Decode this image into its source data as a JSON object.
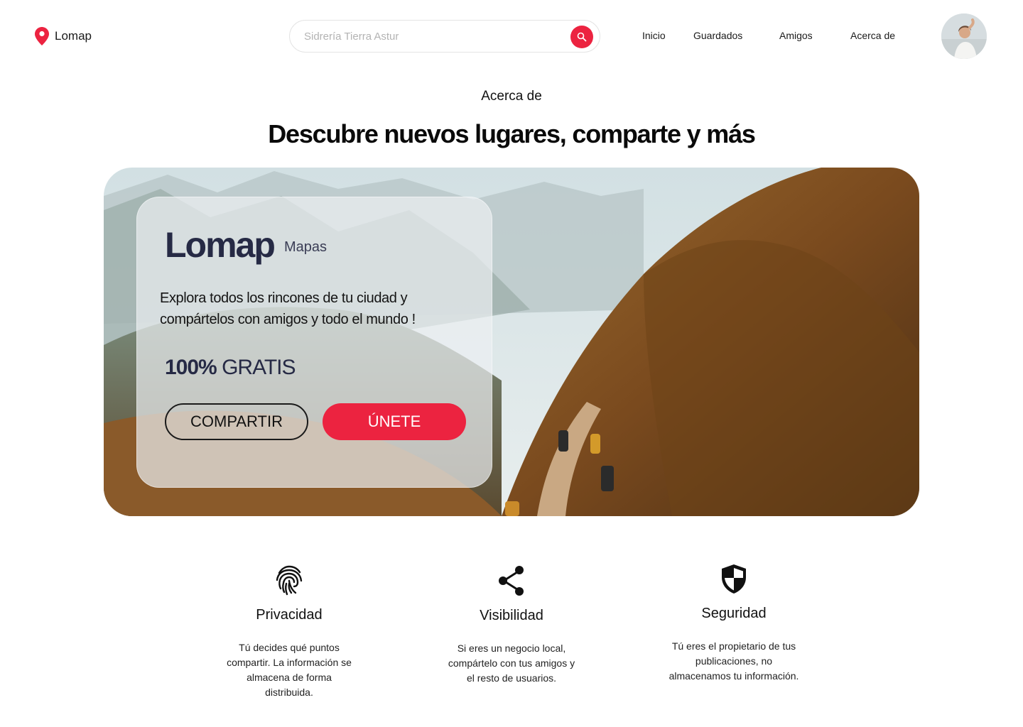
{
  "header": {
    "logo_text": "Lomap",
    "search": {
      "placeholder": "Sidrería Tierra Astur",
      "value": ""
    },
    "nav": [
      "Inicio",
      "Guardados",
      "Amigos",
      "Acerca de"
    ]
  },
  "page": {
    "eyebrow": "Acerca de",
    "headline": "Descubre nuevos lugares, comparte y más"
  },
  "hero": {
    "brand": "Lomap",
    "brand_sub": "Mapas",
    "description": "Explora todos los rincones de tu ciudad y compártelos con amigos y todo el mundo !",
    "free_percent": "100%",
    "free_text": "GRATIS",
    "share_button": "COMPARTIR",
    "join_button": "ÚNETE"
  },
  "features": [
    {
      "icon": "fingerprint-icon",
      "title": "Privacidad",
      "text": "Tú decides qué puntos compartir. La información se almacena de forma distribuida."
    },
    {
      "icon": "share-icon",
      "title": "Visibilidad",
      "text": "Si eres un negocio local, compártelo con tus amigos y el resto de usuarios."
    },
    {
      "icon": "shield-icon",
      "title": "Seguridad",
      "text": "Tú eres el propietario de tus publicaciones, no almacenamos tu información."
    }
  ],
  "colors": {
    "accent": "#ec2340",
    "brand_text": "#262a45"
  }
}
